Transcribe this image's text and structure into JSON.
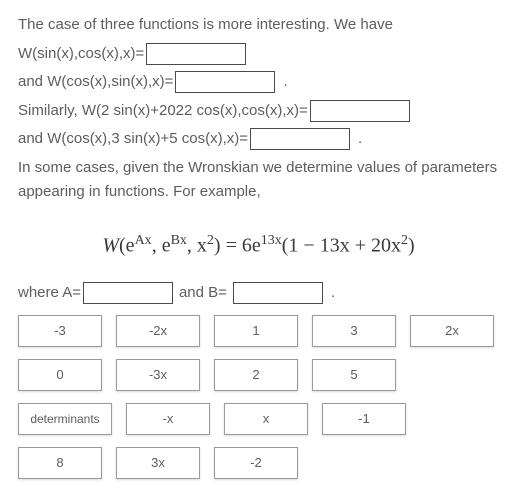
{
  "intro": "The case of three functions is more interesting. We have",
  "lines": {
    "l1_pre": "W(sin(x),cos(x),x)=",
    "l2_pre": "and W(cos(x),sin(x),x)=",
    "l3_pre": "Similarly, W(2 sin(x)+2022 cos(x),cos(x),x)=",
    "l4_pre": "and W(cos(x),3 sin(x)+5 cos(x),x)="
  },
  "para2a": "In some cases, given the Wronskian we determine values of parameters",
  "para2b": "appearing in functions. For example,",
  "equation": {
    "lhs_W": "W",
    "lhs_open": "(e",
    "A_exp": "Ax",
    "comma1": ", e",
    "B_exp": "Bx",
    "comma2": ", x",
    "sq": "2",
    "lhs_close": ") = 6e",
    "exp13": "13x",
    "rhs_open": "(1 − 13x + 20x",
    "rhs_sq": "2",
    "rhs_close": ")"
  },
  "where": {
    "pre": "where A=",
    "mid": "and B=",
    "period": "."
  },
  "tiles": [
    "-3",
    "-2x",
    "1",
    "3",
    "2x",
    "0",
    "-3x",
    "2",
    "5",
    "determinants",
    "-x",
    "x",
    "-1",
    "8",
    "3x",
    "-2"
  ]
}
